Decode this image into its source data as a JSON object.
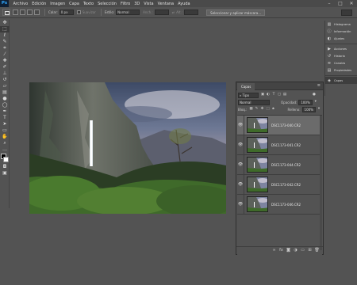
{
  "app": {
    "logo": "Ps"
  },
  "menu": [
    "Archivo",
    "Edición",
    "Imagen",
    "Capa",
    "Texto",
    "Selección",
    "Filtro",
    "3D",
    "Vista",
    "Ventana",
    "Ayuda"
  ],
  "window_controls": [
    "–",
    "□",
    "✕"
  ],
  "options": {
    "feather_label": "Calar:",
    "feather_value": "0 px",
    "antialias_label": "Suavizar",
    "style_label": "Estilo:",
    "style_value": "Normal",
    "width_label": "Anch.:",
    "height_label": "Alt.:",
    "select_mask_button": "Seleccionar y aplicar máscara..."
  },
  "tools": [
    "move-icon",
    "marquee-icon",
    "lasso-icon",
    "quick-select-icon",
    "crop-icon",
    "eyedropper-icon",
    "healing-icon",
    "brush-icon",
    "stamp-icon",
    "history-brush-icon",
    "eraser-icon",
    "gradient-icon",
    "blur-icon",
    "dodge-icon",
    "pen-icon",
    "type-icon",
    "path-select-icon",
    "shape-icon",
    "hand-icon",
    "zoom-icon",
    "more-icon"
  ],
  "right_panels": {
    "group1": [
      {
        "label": "Histograma",
        "icon": "histogram-icon"
      },
      {
        "label": "Información",
        "icon": "info-icon"
      },
      {
        "label": "Ajustes",
        "icon": "adjustments-icon"
      }
    ],
    "group2": [
      {
        "label": "Acciones",
        "icon": "actions-icon"
      },
      {
        "label": "Historia",
        "icon": "history-icon"
      },
      {
        "label": "Canales",
        "icon": "channels-icon"
      },
      {
        "label": "Propiedades",
        "icon": "properties-icon"
      }
    ],
    "group3": [
      {
        "label": "Capas",
        "icon": "layers-icon"
      }
    ]
  },
  "layers_panel": {
    "tab": "Capas",
    "filter_value": "Tipo",
    "blend_mode": "Normal",
    "opacity_label": "Opacidad:",
    "opacity_value": "100%",
    "lock_label": "Bloq.:",
    "fill_label": "Relleno:",
    "fill_value": "100%",
    "layers": [
      {
        "name": "DSC1173-040.CR2",
        "selected": true
      },
      {
        "name": "DSC1173-041.CR2",
        "selected": false
      },
      {
        "name": "DSC1173-044.CR2",
        "selected": false
      },
      {
        "name": "DSC1173-042.CR2",
        "selected": false
      },
      {
        "name": "DSC1173-046.CR2",
        "selected": false
      }
    ]
  },
  "colors": {
    "accent": "#31a8ff",
    "workspace": "#535353",
    "panel_dark": "#3b3b3b",
    "selected_layer": "#6b6b6b"
  }
}
